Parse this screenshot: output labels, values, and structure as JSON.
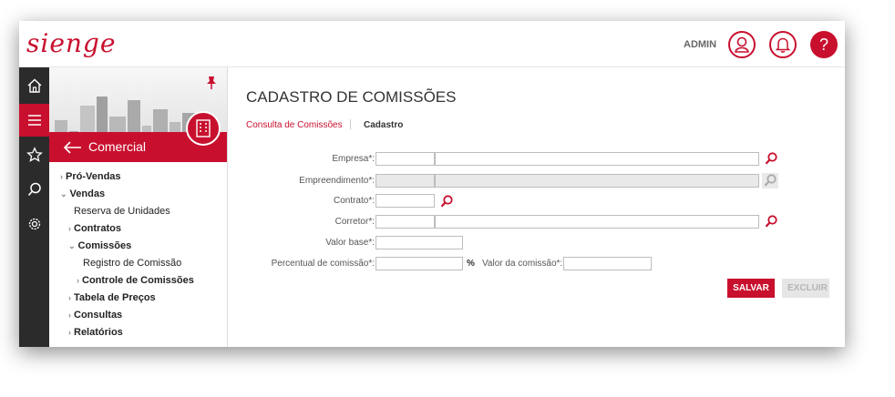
{
  "app": {
    "logo_text": "sienge",
    "user_label": "ADMIN",
    "help_label": "?"
  },
  "colors": {
    "brand": "#c8102e",
    "rail_bg": "#2b2b2b"
  },
  "rail": {
    "icons": [
      "home-icon",
      "menu-icon",
      "star-icon",
      "search-icon",
      "settings-icon"
    ]
  },
  "sidebar": {
    "module_title": "Comercial",
    "items": [
      {
        "label": "Pró-Vendas",
        "bold": true,
        "chevron": "›"
      },
      {
        "label": "Vendas",
        "bold": true,
        "chevron": "⌄"
      },
      {
        "label": "Reserva de Unidades",
        "bold": false,
        "chevron": ""
      },
      {
        "label": "Contratos",
        "bold": true,
        "chevron": "›"
      },
      {
        "label": "Comissões",
        "bold": true,
        "chevron": "⌄"
      },
      {
        "label": "Registro de Comissão",
        "bold": false,
        "chevron": ""
      },
      {
        "label": "Controle de Comissões",
        "bold": true,
        "chevron": "›"
      },
      {
        "label": "Tabela de Preços",
        "bold": true,
        "chevron": "›"
      },
      {
        "label": "Consultas",
        "bold": true,
        "chevron": "›"
      },
      {
        "label": "Relatórios",
        "bold": true,
        "chevron": "›"
      }
    ]
  },
  "page": {
    "title": "CADASTRO DE COMISSÕES",
    "breadcrumb": {
      "link": "Consulta de Comissões",
      "current": "Cadastro"
    }
  },
  "form": {
    "empresa_label": "Empresa*:",
    "empreendimento_label": "Empreendimento*:",
    "contrato_label": "Contrato*:",
    "corretor_label": "Corretor*:",
    "valor_base_label": "Valor base*:",
    "percentual_label": "Percentual de comissão*:",
    "percent_sign": "%",
    "valor_comissao_label": "Valor da comissão*:"
  },
  "actions": {
    "save": "SALVAR",
    "delete": "EXCLUIR"
  }
}
